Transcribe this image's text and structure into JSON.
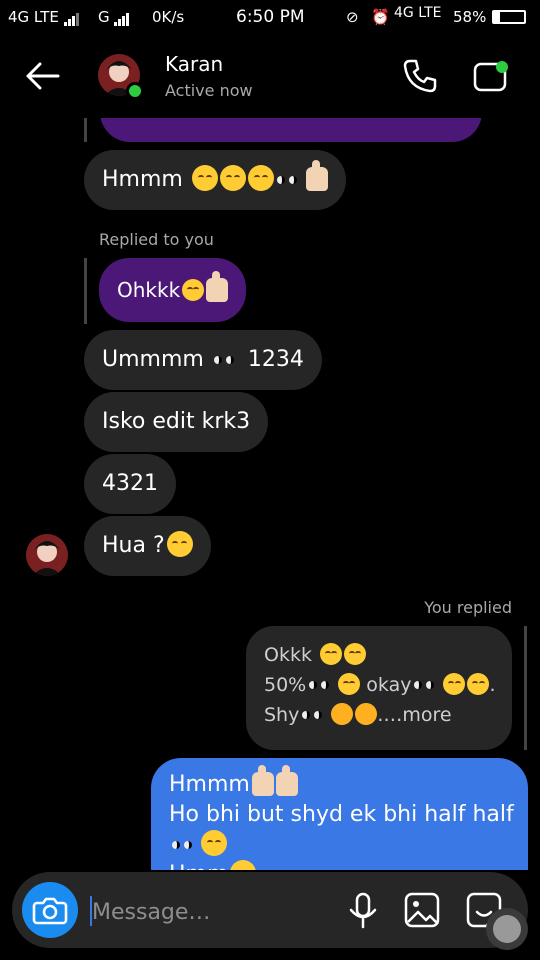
{
  "status_bar": {
    "left": "4G LTE",
    "network2": "G",
    "speed": "0K/s",
    "time": "6:50 PM",
    "network_right": "4G LTE",
    "battery": "58%"
  },
  "header": {
    "contact_name": "Karan",
    "contact_status": "Active now",
    "icons": [
      "back-arrow-icon",
      "phone-icon",
      "video-call-icon"
    ]
  },
  "messages": {
    "m1": {
      "text": "Hmmm"
    },
    "replied_label": "Replied to you",
    "m2": {
      "text": "Ohkkk"
    },
    "m3": {
      "text": "Ummmm",
      "suffix": "1234"
    },
    "m4": {
      "text": "Isko edit krk3"
    },
    "m5": {
      "text": "4321"
    },
    "m6": {
      "text": "Hua ?"
    },
    "you_replied_label": "You replied",
    "reply_quote": {
      "line1": "Okkk",
      "line2a": "50%",
      "line2b": "okay",
      "line3a": "Shy",
      "line3b": ".…more"
    },
    "m7": {
      "line1": "Hmmm",
      "line2": "Ho bhi but shyd ek bhi half half",
      "line4": "Hmm"
    }
  },
  "composer": {
    "placeholder": "Message…",
    "icons": [
      "camera-icon",
      "microphone-icon",
      "gallery-icon",
      "sticker-icon"
    ]
  }
}
